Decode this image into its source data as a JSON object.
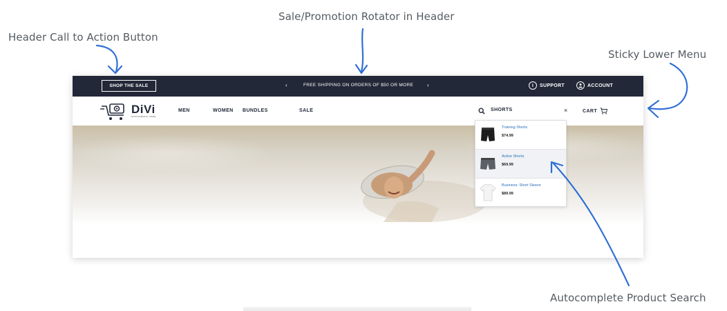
{
  "annotations": {
    "rotator": "Sale/Promotion Rotator in Header",
    "cta": "Header Call to Action Button",
    "sticky": "Sticky Lower Menu",
    "search": "Autocomplete Product Search"
  },
  "topbar": {
    "cta_label": "SHOP THE SALE",
    "promo_text": "FREE SHIPPING ON ORDERS OF $50 OR MORE",
    "prev_glyph": "‹",
    "next_glyph": "›",
    "support_label": "SUPPORT",
    "account_label": "ACCOUNT"
  },
  "logo": {
    "text": "DiVi",
    "subtext": "WOOCOMMERCE THEME"
  },
  "nav": {
    "items": [
      "MEN",
      "WOMEN",
      "BUNDLES",
      "SALE"
    ]
  },
  "search": {
    "value": "SHORTS",
    "clear_glyph": "×"
  },
  "cart": {
    "label": "CART"
  },
  "search_results": [
    {
      "name": "Training Shorts",
      "price": "$74.99",
      "thumb": "black-shorts-icon"
    },
    {
      "name": "Active Shorts",
      "price": "$69.99",
      "thumb": "gray-shorts-icon"
    },
    {
      "name": "Business: Short Sleeve",
      "price": "$89.99",
      "thumb": "white-shirt-icon"
    }
  ],
  "colors": {
    "header_bg": "#222838",
    "annotation_arrow": "#2f6fd6",
    "link": "#2a6ebb"
  }
}
